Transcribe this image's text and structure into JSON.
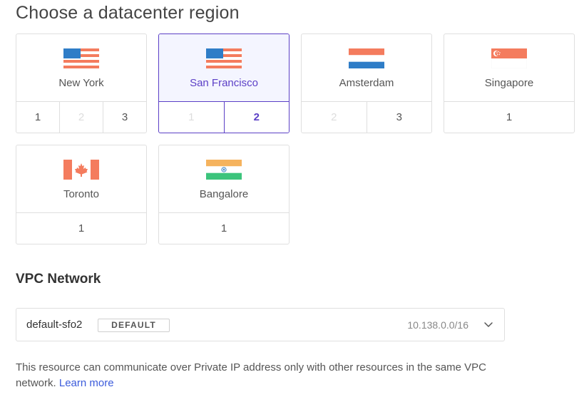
{
  "page": {
    "title": "Choose a datacenter region"
  },
  "regions": [
    {
      "name": "New York",
      "flag": "usa-flag",
      "selected": false,
      "datacenters": [
        {
          "label": "1",
          "state": "available"
        },
        {
          "label": "2",
          "state": "disabled"
        },
        {
          "label": "3",
          "state": "available"
        }
      ]
    },
    {
      "name": "San Francisco",
      "flag": "usa-flag",
      "selected": true,
      "datacenters": [
        {
          "label": "1",
          "state": "disabled"
        },
        {
          "label": "2",
          "state": "active"
        }
      ]
    },
    {
      "name": "Amsterdam",
      "flag": "netherlands-flag",
      "selected": false,
      "datacenters": [
        {
          "label": "2",
          "state": "disabled"
        },
        {
          "label": "3",
          "state": "available"
        }
      ]
    },
    {
      "name": "Singapore",
      "flag": "singapore-flag",
      "selected": false,
      "datacenters": [
        {
          "label": "1",
          "state": "available"
        }
      ]
    },
    {
      "name": "Toronto",
      "flag": "canada-flag",
      "selected": false,
      "datacenters": [
        {
          "label": "1",
          "state": "available"
        }
      ]
    },
    {
      "name": "Bangalore",
      "flag": "india-flag",
      "selected": false,
      "datacenters": [
        {
          "label": "1",
          "state": "available"
        }
      ]
    }
  ],
  "vpc": {
    "title": "VPC Network",
    "selected_name": "default-sfo2",
    "badge": "DEFAULT",
    "ip_range": "10.138.0.0/16",
    "icon": "chevron-down-icon"
  },
  "note": {
    "text": "This resource can communicate over Private IP address only with other resources in the same VPC network.",
    "link": "Learn more"
  },
  "colors": {
    "accent": "#5b3fc6",
    "selected_bg": "#f4f5ff",
    "border": "#dfdfdf",
    "link": "#3b5bdb",
    "flag_blue": "#2f7dc7",
    "flag_red": "#f47c5e",
    "flag_orange": "#f5b35e",
    "flag_green": "#3cc47c"
  }
}
